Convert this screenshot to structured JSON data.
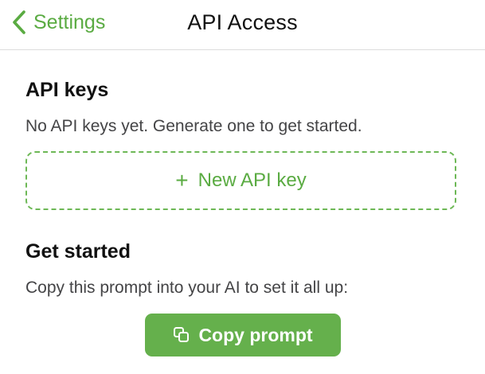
{
  "nav": {
    "back_label": "Settings",
    "title": "API Access"
  },
  "api_keys": {
    "heading": "API keys",
    "empty_text": "No API keys yet. Generate one to get started.",
    "new_key_plus": "+",
    "new_key_label": "New API key"
  },
  "get_started": {
    "heading": "Get started",
    "description": "Copy this prompt into your AI to set it all up:",
    "copy_label": "Copy prompt"
  },
  "icons": {
    "back": "chevron-left-icon",
    "add": "plus-icon",
    "copy": "copy-icon"
  },
  "colors": {
    "accent": "#5aab42",
    "button_fill": "#65b04c",
    "text_primary": "#111111",
    "text_secondary": "#444446"
  }
}
